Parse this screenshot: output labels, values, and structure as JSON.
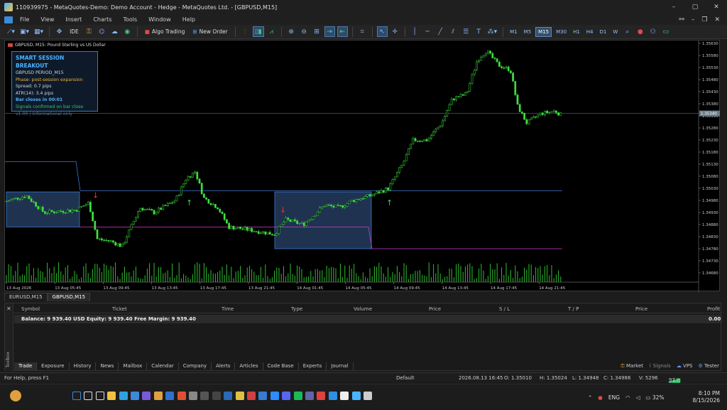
{
  "window": {
    "title": "110939975 - MetaQuotes-Demo: Demo Account - Hedge - MetaQuotes Ltd. - [GBPUSD,M15]",
    "min": "–",
    "max": "▢",
    "close": "✕"
  },
  "menu": {
    "items": [
      "File",
      "View",
      "Insert",
      "Charts",
      "Tools",
      "Window",
      "Help"
    ]
  },
  "toolbar": {
    "ide": "IDE",
    "algo": "Algo Trading",
    "new_order": "New Order",
    "timeframes": [
      "M1",
      "M5",
      "M15",
      "M30",
      "H1",
      "H4",
      "D1",
      "W",
      "MN"
    ],
    "selected_tf": "M15"
  },
  "chart": {
    "label": "GBPUSD, M15:  Pound Sterling vs US Dollar",
    "current_price": "1.35340",
    "price_ticks": [
      "1.35630",
      "1.35580",
      "1.35530",
      "1.35480",
      "1.35430",
      "1.35380",
      "1.35330",
      "1.35280",
      "1.35230",
      "1.35180",
      "1.35130",
      "1.35080",
      "1.35030",
      "1.34980",
      "1.34930",
      "1.34880",
      "1.34830",
      "1.34780",
      "1.34730",
      "1.34680"
    ],
    "time_ticks": [
      "13 Aug 2026",
      "13 Aug 05:45",
      "13 Aug 09:45",
      "13 Aug 13:45",
      "13 Aug 17:45",
      "13 Aug 21:45",
      "14 Aug 01:45",
      "14 Aug 05:45",
      "14 Aug 09:45",
      "14 Aug 13:45",
      "14 Aug 17:45",
      "14 Aug 21:45"
    ],
    "colors": {
      "bull": "#3fe03f",
      "bear": "#3fe03f",
      "session_box": "#1f3350",
      "range_high": "#3a7bd5",
      "range_low": "#d03ad0",
      "sell_arrow": "#ff2a2a",
      "buy_arrow": "#2ad84a"
    }
  },
  "panel": {
    "title": "SMART SESSION BREAKOUT",
    "symbol": "GBPUSD  PERIOD_M15",
    "phase": "Phase: post-session expansion",
    "spread": "Spread: 0.7 pips",
    "atr": "ATR(14): 3.4 pips",
    "bar_close": "Bar closes in 00:01",
    "signals": "Signals confirmed on bar close",
    "version": "v1.00 | Informational only"
  },
  "chart_tabs": [
    "EURUSD,M15",
    "GBPUSD,M15"
  ],
  "toolbox": {
    "columns": [
      "Symbol",
      "Ticket",
      "Time",
      "Type",
      "Volume",
      "Price",
      "S / L",
      "T / P",
      "Price",
      "Profit"
    ],
    "balance_line": "Balance: 9 939.40 USD  Equity: 9 939.40  Free Margin: 9 939.40",
    "profit": "0.00",
    "tabs": [
      "Trade",
      "Exposure",
      "History",
      "News",
      "Mailbox",
      "Calendar",
      "Company",
      "Alerts",
      "Articles",
      "Code Base",
      "Experts",
      "Journal"
    ],
    "right": [
      "Market",
      "Signals",
      "VPS",
      "Tester"
    ],
    "side_label": "Toolbox"
  },
  "status": {
    "help": "For Help, press F1",
    "profile": "Default",
    "datetime": "2026.08.13 16:45",
    "open": "O: 1.35010",
    "high": "H: 1.35024",
    "low": "L: 1.34948",
    "close": "C: 1.34986",
    "volume": "V: 5296",
    "traffic": "97 / 7 Kb"
  },
  "taskbar": {
    "lang": "ENG",
    "battery": "32%",
    "time": "8:10 PM",
    "date": "8/15/2026"
  }
}
